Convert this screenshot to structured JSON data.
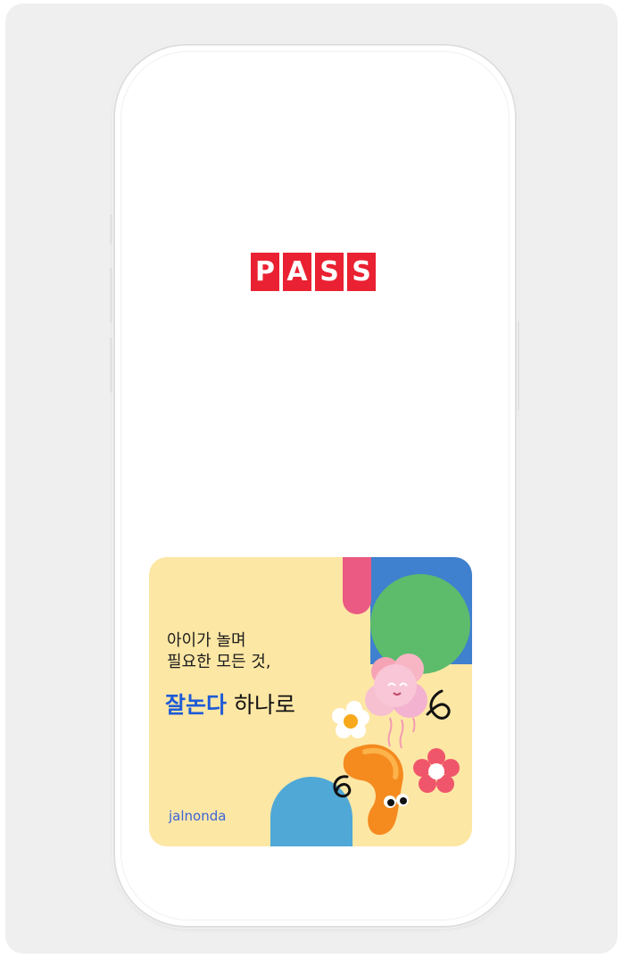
{
  "splash": {
    "logo_letters": [
      "P",
      "A",
      "S",
      "S"
    ],
    "logo_color": "#ea2132"
  },
  "banner": {
    "tagline_line1": "아이가 놀며",
    "tagline_line2": "필요한 모든 것,",
    "headline_accent": "잘논다",
    "headline_rest": " 하나로",
    "brand": "jalnonda",
    "accent_color": "#1e5bd6",
    "background_color": "#fde7a5"
  }
}
